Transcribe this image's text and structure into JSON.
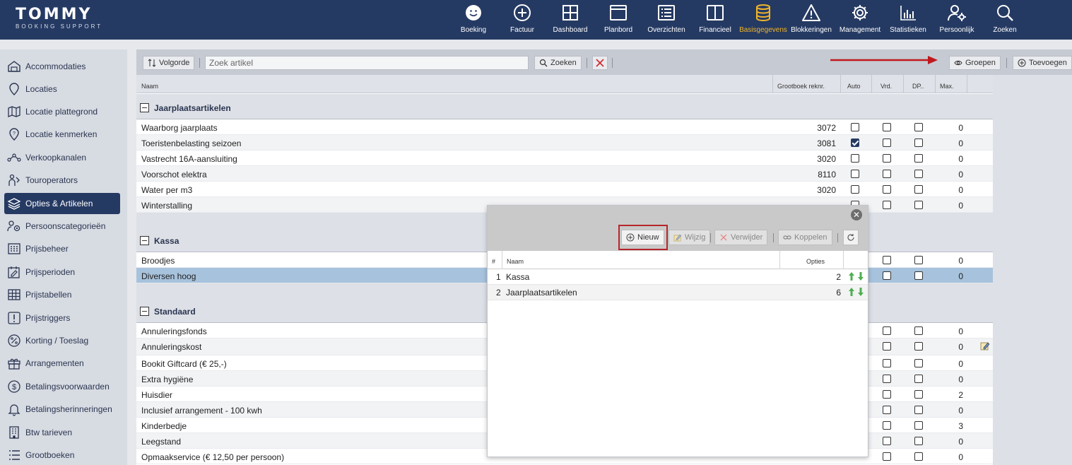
{
  "header": {
    "logo_title": "TOMMY",
    "logo_subtitle": "BOOKING SUPPORT",
    "nav": [
      {
        "label": "Boeking",
        "icon": "smiley-icon"
      },
      {
        "label": "Factuur",
        "icon": "plus-circle-icon"
      },
      {
        "label": "Dashboard",
        "icon": "grid-icon"
      },
      {
        "label": "Planbord",
        "icon": "panel-icon"
      },
      {
        "label": "Overzichten",
        "icon": "list-icon"
      },
      {
        "label": "Financieel",
        "icon": "columns-icon"
      },
      {
        "label": "Basisgegevens",
        "icon": "database-icon",
        "active": true
      },
      {
        "label": "Blokkeringen",
        "icon": "warning-icon"
      },
      {
        "label": "Management",
        "icon": "gear-icon"
      },
      {
        "label": "Statistieken",
        "icon": "bar-chart-icon"
      },
      {
        "label": "Persoonlijk",
        "icon": "user-gear-icon"
      },
      {
        "label": "Zoeken",
        "icon": "search-icon"
      }
    ],
    "active_color": "#f0b429",
    "background": "#253a63"
  },
  "sidebar": {
    "items": [
      {
        "label": "Accommodaties",
        "icon": "house-icon"
      },
      {
        "label": "Locaties",
        "icon": "map-pin-icon"
      },
      {
        "label": "Locatie plattegrond",
        "icon": "map-icon"
      },
      {
        "label": "Locatie kenmerken",
        "icon": "map-pin-question-icon"
      },
      {
        "label": "Verkoopkanalen",
        "icon": "network-icon"
      },
      {
        "label": "Touroperators",
        "icon": "people-icon"
      },
      {
        "label": "Opties & Artikelen",
        "icon": "layers-icon",
        "active": true
      },
      {
        "label": "Persoonscategorieën",
        "icon": "person-gear-icon"
      },
      {
        "label": "Prijsbeheer",
        "icon": "calculator-icon"
      },
      {
        "label": "Prijsperioden",
        "icon": "calendar-edit-icon"
      },
      {
        "label": "Prijstabellen",
        "icon": "table-icon"
      },
      {
        "label": "Prijstriggers",
        "icon": "exclamation-icon"
      },
      {
        "label": "Korting / Toeslag",
        "icon": "percent-icon"
      },
      {
        "label": "Arrangementen",
        "icon": "gift-icon"
      },
      {
        "label": "Betalingsvoorwaarden",
        "icon": "dollar-icon"
      },
      {
        "label": "Betalingsherinneringen",
        "icon": "bell-icon"
      },
      {
        "label": "Btw tarieven",
        "icon": "building-icon"
      },
      {
        "label": "Grootboeken",
        "icon": "list-lines-icon"
      }
    ]
  },
  "toolbar": {
    "sort_label": "Volgorde",
    "search_placeholder": "Zoek artikel",
    "search_label": "Zoeken",
    "groups_label": "Groepen",
    "add_label": "Toevoegen"
  },
  "columns": {
    "name": "Naam",
    "ledger": "Grootboek reknr.",
    "auto": "Auto",
    "vrd": "Vrd.",
    "dp": "DP..",
    "max": "Max."
  },
  "groups": [
    {
      "name": "Jaarplaatsartikelen",
      "rows": [
        {
          "name": "Waarborg jaarplaats",
          "ledger": "3072",
          "auto": false,
          "max": "0"
        },
        {
          "name": "Toeristenbelasting seizoen",
          "ledger": "3081",
          "auto": true,
          "max": "0"
        },
        {
          "name": "Vastrecht 16A-aansluiting",
          "ledger": "3020",
          "auto": false,
          "max": "0"
        },
        {
          "name": "Voorschot elektra",
          "ledger": "8110",
          "auto": false,
          "max": "0"
        },
        {
          "name": "Water per m3",
          "ledger": "3020",
          "auto": false,
          "max": "0"
        },
        {
          "name": "Winterstalling",
          "ledger": "",
          "auto": false,
          "max": "0"
        }
      ]
    },
    {
      "name": "Kassa",
      "rows": [
        {
          "name": "Broodjes",
          "max": "0"
        },
        {
          "name": "Diversen hoog",
          "max": "0",
          "selected": true
        }
      ]
    },
    {
      "name": "Standaard",
      "rows": [
        {
          "name": "Annuleringsfonds",
          "max": "0"
        },
        {
          "name": "Annuleringskost",
          "max": "0",
          "edit": true
        },
        {
          "name": "Bookit Giftcard (€ 25,-)",
          "max": "0"
        },
        {
          "name": "Extra hygiëne",
          "max": "0"
        },
        {
          "name": "Huisdier",
          "max": "2"
        },
        {
          "name": "Inclusief arrangement - 100 kwh",
          "max": "0"
        },
        {
          "name": "Kinderbedje",
          "max": "3"
        },
        {
          "name": "Leegstand",
          "max": "0"
        },
        {
          "name": "Opmaakservice (€ 12,50 per persoon)",
          "max": "0"
        }
      ]
    }
  ],
  "modal": {
    "buttons": {
      "new": "Nieuw",
      "edit": "Wijzig",
      "delete": "Verwijder",
      "link": "Koppelen"
    },
    "columns": {
      "index": "#",
      "name": "Naam",
      "options": "Opties"
    },
    "rows": [
      {
        "index": "1",
        "name": "Kassa",
        "options": "2"
      },
      {
        "index": "2",
        "name": "Jaarplaatsartikelen",
        "options": "6"
      }
    ],
    "highlight_color": "#b5262a"
  }
}
